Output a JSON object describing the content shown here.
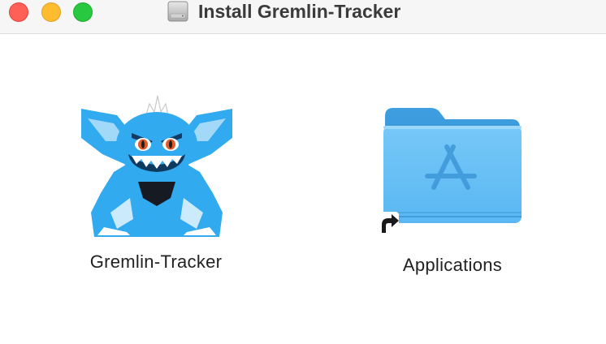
{
  "window": {
    "title": "Install Gremlin-Tracker",
    "title_icon": "disk-image-icon"
  },
  "traffic_lights": {
    "close_color": "#fe5f57",
    "minimize_color": "#febc2e",
    "zoom_color": "#28c840"
  },
  "items": {
    "app": {
      "label": "Gremlin-Tracker",
      "icon": "gremlin-app-icon",
      "accent": "#2fa9f0"
    },
    "applications": {
      "label": "Applications",
      "icon": "applications-folder-icon",
      "alias": "alias-arrow-icon",
      "accent": "#5cc0f5"
    }
  }
}
